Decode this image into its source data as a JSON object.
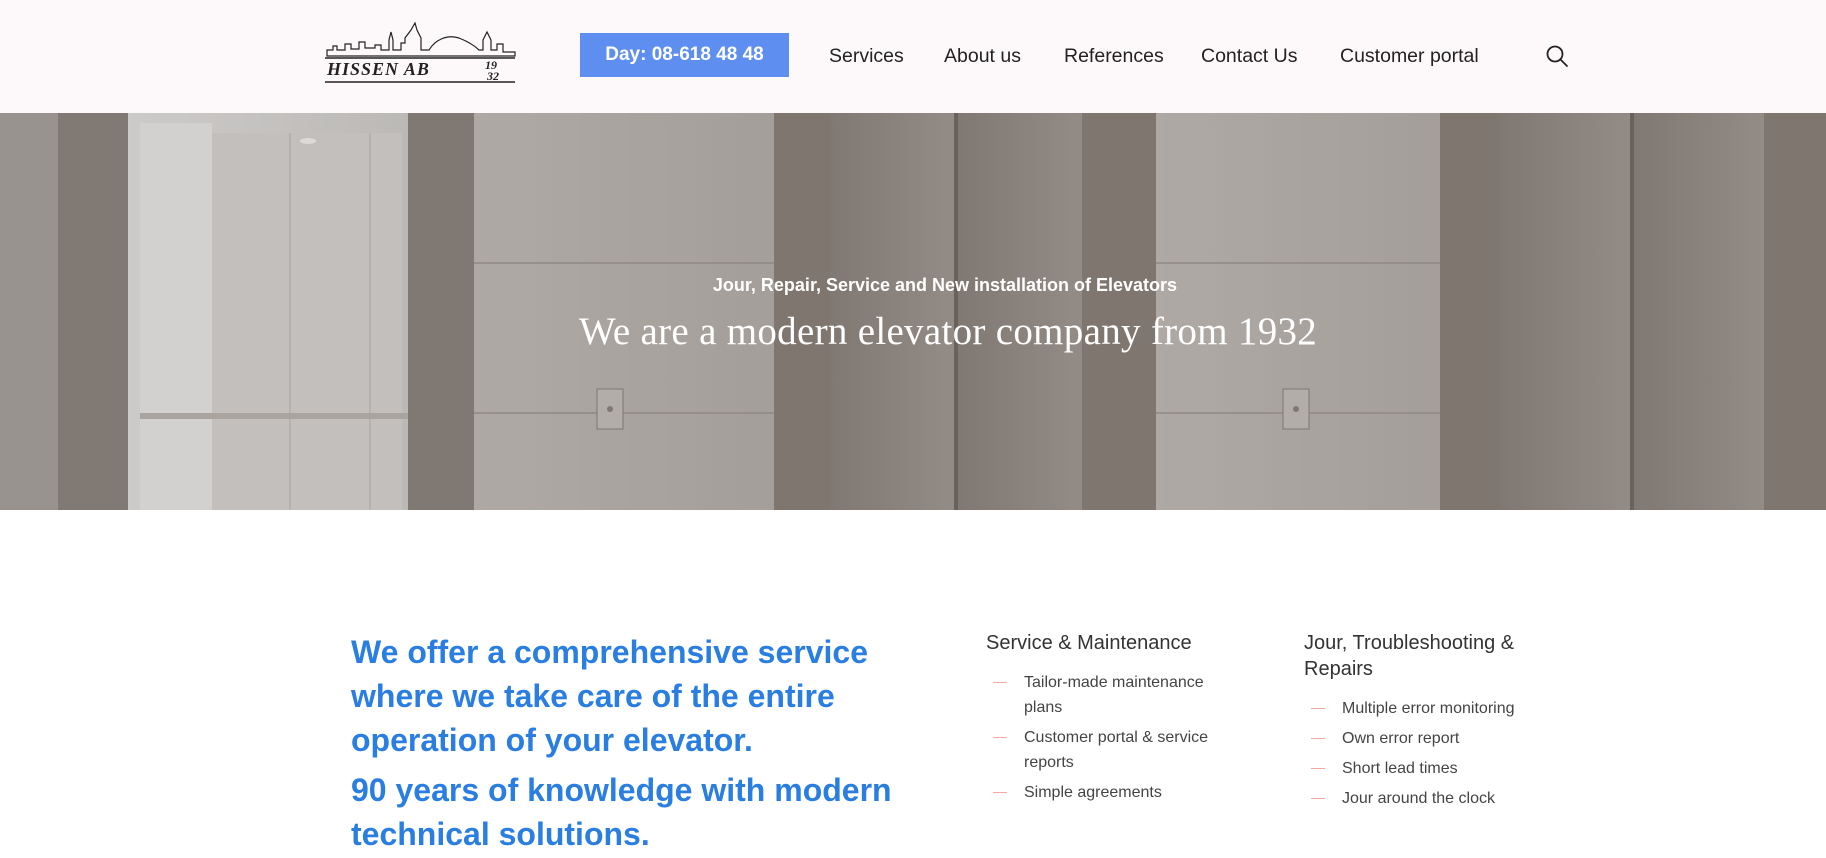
{
  "header": {
    "logo_text": "HISSEN AB 1932",
    "phone_label": "Day: 08-618 48 48",
    "nav": [
      {
        "label": "Services"
      },
      {
        "label": "About us"
      },
      {
        "label": "References"
      },
      {
        "label": "Contact Us"
      },
      {
        "label": "Customer portal"
      }
    ],
    "search_icon": "search-icon"
  },
  "hero": {
    "subtitle": "Jour, Repair, Service and New installation of Elevators",
    "title": "We are a modern elevator company from 1932"
  },
  "intro": {
    "line1": "We offer a comprehensive service where we take care of the entire operation of your elevator.",
    "line2": "90 years of knowledge with modern technical solutions."
  },
  "columns": [
    {
      "title": "Service & Maintenance",
      "items": [
        "Tailor-made maintenance plans",
        "Customer portal & service reports",
        "Simple agreements"
      ]
    },
    {
      "title": "Jour, Troubleshooting & Repairs",
      "items": [
        "Multiple error monitoring",
        "Own error report",
        "Short lead times",
        "Jour around the clock"
      ]
    }
  ],
  "colors": {
    "accent_blue": "#2a7de1",
    "button_blue": "#5e8ff0",
    "dash_pink": "#f2a7a0",
    "header_bg": "#fdf9fb"
  }
}
